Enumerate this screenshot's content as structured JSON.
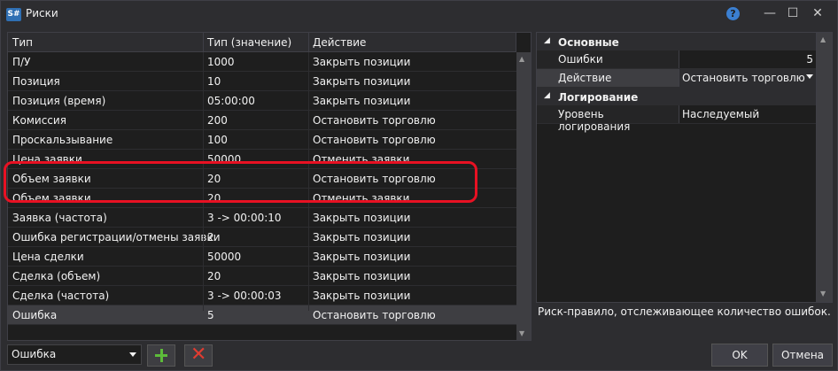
{
  "window": {
    "app_icon": "S#",
    "title": "Риски",
    "controls": [
      "?",
      "—",
      "☐",
      "✕"
    ]
  },
  "grid": {
    "headers": [
      "Тип",
      "Тип (значение)",
      "Действие"
    ],
    "rows": [
      [
        "П/У",
        "1000",
        "Закрыть позиции"
      ],
      [
        "Позиция",
        "10",
        "Закрыть позиции"
      ],
      [
        "Позиция (время)",
        "05:00:00",
        "Закрыть позиции"
      ],
      [
        "Комиссия",
        "200",
        "Остановить торговлю"
      ],
      [
        "Проскальзывание",
        "100",
        "Остановить торговлю"
      ],
      [
        "Цена заявки",
        "50000",
        "Отменить заявки"
      ],
      [
        "Объем заявки",
        "20",
        "Остановить торговлю"
      ],
      [
        "Объем заявки",
        "20",
        "Отменить заявки"
      ],
      [
        "Заявка (частота)",
        "3 -> 00:00:10",
        "Закрыть позиции"
      ],
      [
        "Ошибка регистрации/отмены заявки",
        "2",
        "Закрыть позиции"
      ],
      [
        "Цена сделки",
        "50000",
        "Закрыть позиции"
      ],
      [
        "Сделка (объем)",
        "20",
        "Закрыть позиции"
      ],
      [
        "Сделка (частота)",
        "3 -> 00:00:03",
        "Закрыть позиции"
      ],
      [
        "Ошибка",
        "5",
        "Остановить торговлю"
      ]
    ],
    "selected_row": 13
  },
  "props": {
    "cat_main": "Основные",
    "errors_label": "Ошибки",
    "errors_value": "5",
    "action_label": "Действие",
    "action_value": "Остановить торговлю",
    "cat_logging": "Логирование",
    "log_level_label": "Уровень логирования",
    "log_level_value": "Наследуемый",
    "description": "Риск-правило, отслеживающее количество ошибок."
  },
  "footer": {
    "rule_type": "Ошибка",
    "ok": "OK",
    "cancel": "Отмена"
  },
  "colors": {
    "background": "#2d2d30",
    "grid_bg": "#1e1e1e",
    "highlight": "#e81123",
    "add": "#5dbb3a",
    "remove": "#e03c31"
  }
}
